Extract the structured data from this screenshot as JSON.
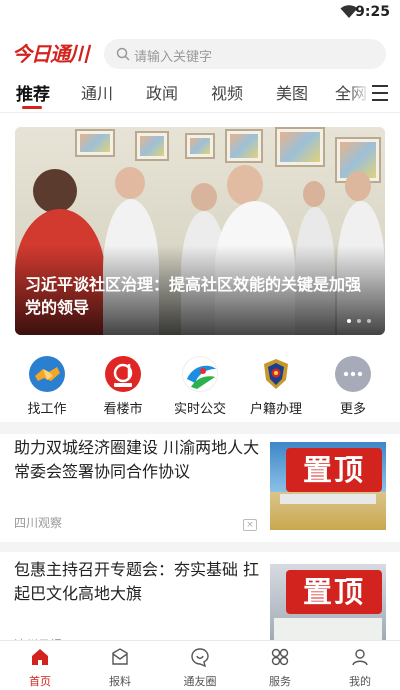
{
  "status_bar": {
    "time": "9:25",
    "wifi_icon": "wifi-icon"
  },
  "header": {
    "logo_text": "今日通川",
    "search_placeholder": "请输入关键字"
  },
  "tabs": [
    {
      "label": "推荐",
      "active": true
    },
    {
      "label": "通川",
      "active": false
    },
    {
      "label": "政闻",
      "active": false
    },
    {
      "label": "视频",
      "active": false
    },
    {
      "label": "美图",
      "active": false
    },
    {
      "label": "全网",
      "active": false
    }
  ],
  "banner": {
    "caption": "习近平谈社区治理：提高社区效能的关键是加强党的领导",
    "dots": 3,
    "active_dot": 0
  },
  "shortcuts": [
    {
      "label": "找工作",
      "icon": "handshake-icon"
    },
    {
      "label": "看楼市",
      "icon": "house-market-icon"
    },
    {
      "label": "实时公交",
      "icon": "bus-icon"
    },
    {
      "label": "户籍办理",
      "icon": "police-badge-icon"
    },
    {
      "label": "更多",
      "icon": "more-icon"
    }
  ],
  "articles": [
    {
      "title": "助力双城经济圈建设 川渝两地人大常委会签署协同合作协议",
      "source": "四川观察",
      "badge": "置顶"
    },
    {
      "title": "包惠主持召开专题会：夯实基础 扛起巴文化高地大旗",
      "source": "达州日报",
      "badge": "置顶"
    }
  ],
  "bottom_nav": [
    {
      "label": "首页",
      "icon": "home-icon",
      "active": true
    },
    {
      "label": "报料",
      "icon": "report-icon",
      "active": false
    },
    {
      "label": "通友圈",
      "icon": "community-icon",
      "active": false
    },
    {
      "label": "服务",
      "icon": "service-icon",
      "active": false
    },
    {
      "label": "我的",
      "icon": "profile-icon",
      "active": false
    }
  ],
  "colors": {
    "accent": "#d2231e",
    "muted_text": "#999999"
  }
}
